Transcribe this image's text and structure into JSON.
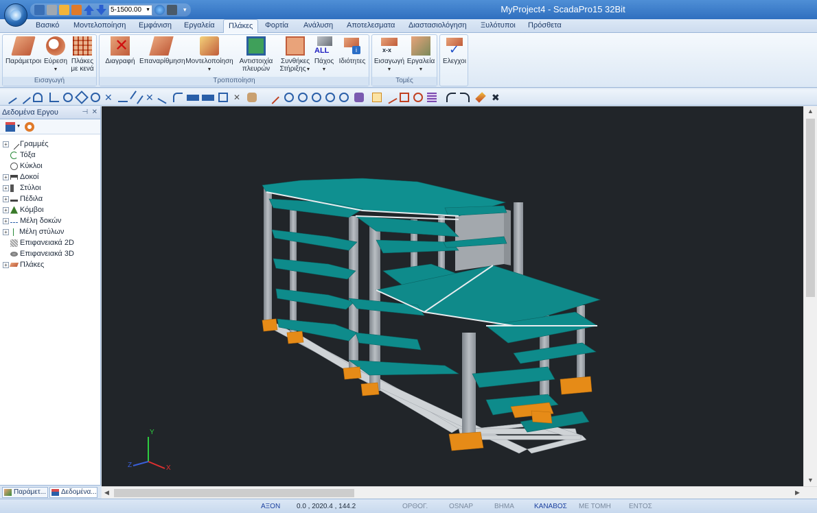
{
  "window": {
    "title": "MyProject4 - ScadaPro15 32Bit"
  },
  "quick_access": {
    "scale_value": "5-1500.00"
  },
  "tabs": [
    "Βασικό",
    "Μοντελοποίηση",
    "Εμφάνιση",
    "Εργαλεία",
    "Πλάκες",
    "Φορτία",
    "Ανάλυση",
    "Αποτελεσματα",
    "Διαστασιολόγηση",
    "Ξυλότυποι",
    "Πρόσθετα"
  ],
  "active_tab": "Πλάκες",
  "ribbon": {
    "groups": [
      {
        "label": "Εισαγωγή",
        "buttons": [
          {
            "label": "Παράμετροι",
            "icon": "slab-settings-icon"
          },
          {
            "label": "Εύρεση",
            "icon": "find-slab-icon",
            "dropdown": true
          },
          {
            "label": "Πλάκες με κενά",
            "icon": "slab-grid-icon"
          }
        ]
      },
      {
        "label": "Τροποποίηση",
        "buttons": [
          {
            "label": "Διαγραφή",
            "icon": "delete-slab-icon"
          },
          {
            "label": "Επαναρίθμηση",
            "icon": "renumber-icon"
          },
          {
            "label": "Μοντελοποίηση",
            "icon": "model-slab-icon",
            "dropdown": true
          },
          {
            "label": "Αντιστοιχία πλευρών",
            "icon": "edge-match-icon"
          },
          {
            "label": "Συνθήκες Στήριξης",
            "icon": "support-conditions-icon",
            "dropdown": true
          },
          {
            "label": "Πάχος",
            "icon": "thickness-all-icon",
            "dropdown": true
          },
          {
            "label": "Ιδιότητες",
            "icon": "properties-icon"
          }
        ]
      },
      {
        "label": "Τομές",
        "buttons": [
          {
            "label": "Εισαγωγή",
            "icon": "section-insert-icon",
            "dropdown": true
          },
          {
            "label": "Εργαλεία",
            "icon": "section-tools-icon",
            "dropdown": true
          }
        ]
      },
      {
        "label": "",
        "buttons": [
          {
            "label": "Ελεγχοι",
            "icon": "checks-icon"
          }
        ]
      }
    ]
  },
  "panel": {
    "title": "Δεδομένα Εργου",
    "tree": [
      {
        "label": "Γραμμές",
        "expandable": true,
        "icon": "line-icon"
      },
      {
        "label": "Τόξα",
        "expandable": false,
        "icon": "arc-icon"
      },
      {
        "label": "Κύκλοι",
        "expandable": false,
        "icon": "circle-icon"
      },
      {
        "label": "Δοκοί",
        "expandable": true,
        "icon": "beam-icon"
      },
      {
        "label": "Στύλοι",
        "expandable": true,
        "icon": "column-icon"
      },
      {
        "label": "Πέδιλα",
        "expandable": true,
        "icon": "footing-icon"
      },
      {
        "label": "Κόμβοι",
        "expandable": true,
        "icon": "node-icon"
      },
      {
        "label": "Μέλη δοκών",
        "expandable": true,
        "icon": "beam-member-icon"
      },
      {
        "label": "Μέλη στύλων",
        "expandable": true,
        "icon": "column-member-icon"
      },
      {
        "label": "Επιφανειακά 2D",
        "expandable": false,
        "icon": "surface-2d-icon"
      },
      {
        "label": "Επιφανειακά 3D",
        "expandable": false,
        "icon": "surface-3d-icon"
      },
      {
        "label": "Πλάκες",
        "expandable": true,
        "icon": "slab-icon"
      }
    ],
    "bottom_tabs": [
      "Παράμετ...",
      "Δεδομένα..."
    ]
  },
  "axes_labels": {
    "y": "Y",
    "x": "X",
    "z": "Z"
  },
  "status": {
    "axis_label": "ΑΞΟΝ",
    "coords": "0.0 , 2020.4 , 144.2",
    "ortho": "ΟΡΘΟΓ.",
    "osnap": "OSNAP",
    "step": "ΒΗΜΑ",
    "grid": "ΚΑΝΑΒΟΣ",
    "section": "ΜΕ ΤΟΜΗ",
    "inside": "ΕΝΤΟΣ"
  },
  "colors": {
    "slab": "#0f8a8a",
    "column": "#9aa0a6",
    "footing": "#e58a1a",
    "viewport_bg": "#212529",
    "active_status": "#1a3f9e"
  }
}
